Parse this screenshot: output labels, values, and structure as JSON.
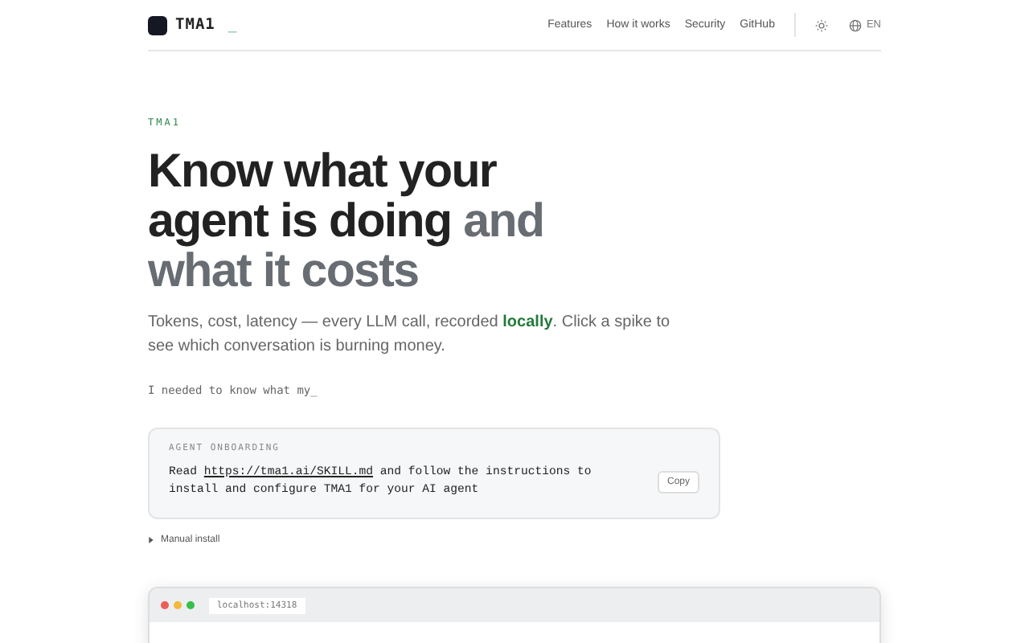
{
  "header": {
    "brand": "TMA1",
    "brand_cursor": "_",
    "nav": [
      {
        "label": "Features"
      },
      {
        "label": "How it works"
      },
      {
        "label": "Security"
      },
      {
        "label": "GitHub"
      }
    ],
    "language": "EN"
  },
  "hero": {
    "eyebrow": "TMA1",
    "title_dark": "Know what your agent is doing",
    "title_muted": "and what it costs",
    "lead": "Tokens, cost, latency — every LLM call, recorded **locally**. Click a spike to see which conversation is burning money.",
    "typing": "I needed to know what my_"
  },
  "onboarding": {
    "label": "AGENT ONBOARDING",
    "text_before": "Read ",
    "link": "https://tma1.ai/SKILL.md",
    "text_after": " and follow the instructions to install and configure TMA1 for your AI agent",
    "copy_button": "Copy"
  },
  "manual_install": {
    "label": "Manual install",
    "expanded": false
  },
  "preview": {
    "address": "localhost:14318"
  }
}
